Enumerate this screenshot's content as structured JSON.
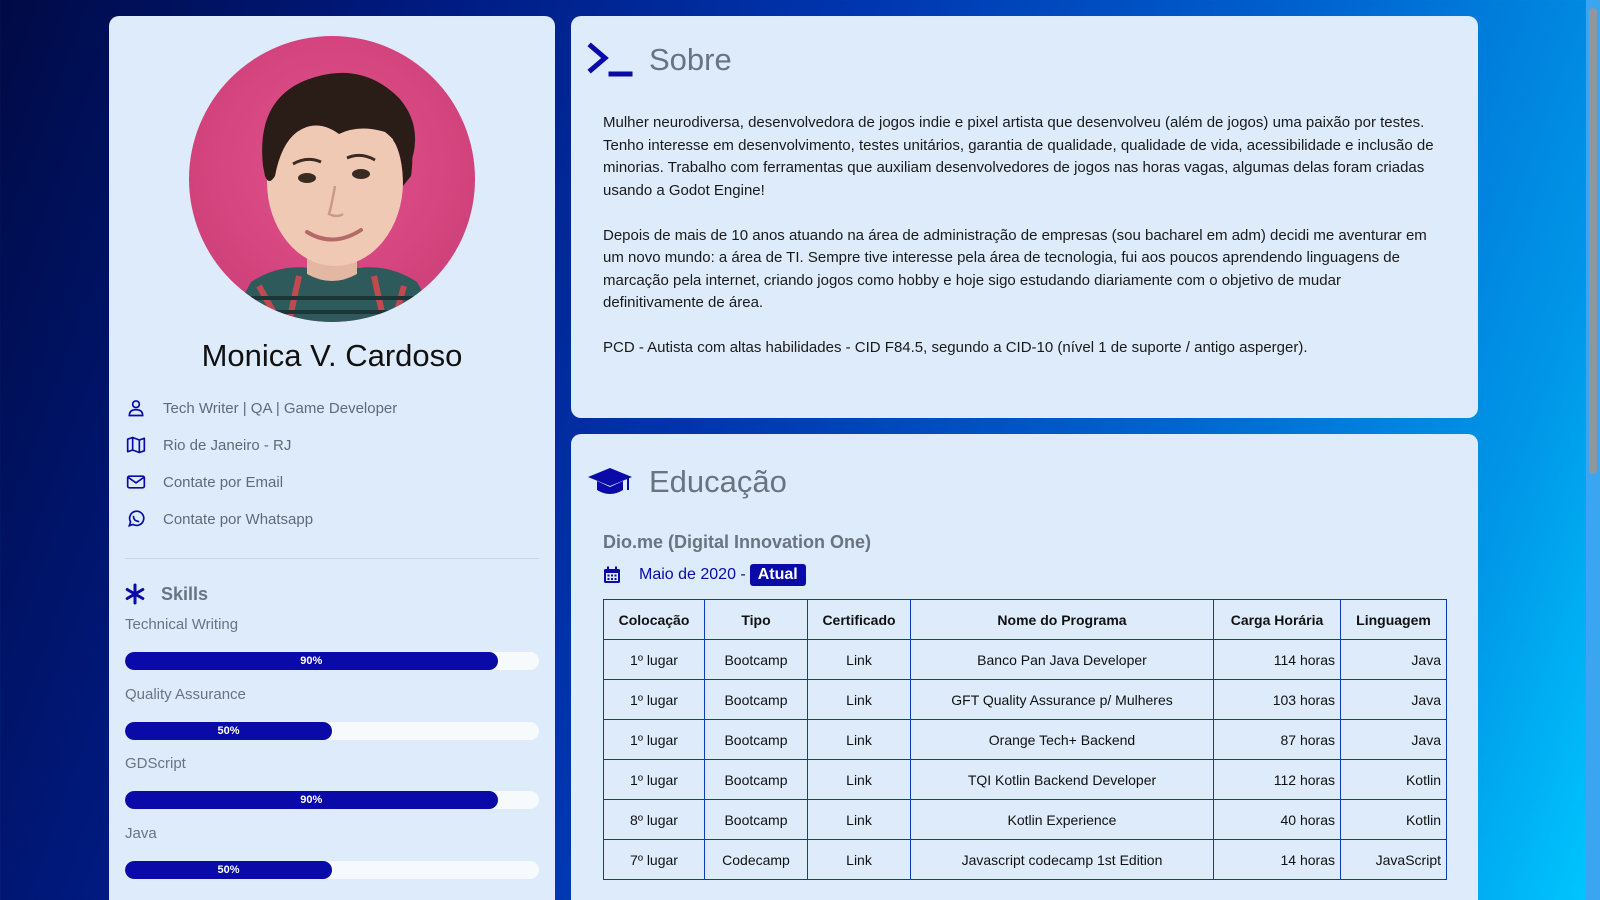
{
  "profile": {
    "name": "Monica V. Cardoso",
    "role": "Tech Writer | QA | Game Developer",
    "location": "Rio de Janeiro - RJ",
    "email_link": "Contate por Email",
    "whatsapp_link": "Contate por Whatsapp"
  },
  "skills": {
    "heading": "Skills",
    "items": [
      {
        "name": "Technical Writing",
        "percent": 90,
        "label": "90%"
      },
      {
        "name": "Quality Assurance",
        "percent": 50,
        "label": "50%"
      },
      {
        "name": "GDScript",
        "percent": 90,
        "label": "90%"
      },
      {
        "name": "Java",
        "percent": 50,
        "label": "50%"
      }
    ]
  },
  "about": {
    "title": "Sobre",
    "paragraphs": [
      "Mulher neurodiversa, desenvolvedora de jogos indie e pixel artista que desenvolveu (além de jogos) uma paixão por testes. Tenho interesse em desenvolvimento, testes unitários, garantia de qualidade, qualidade de vida, acessibilidade e inclusão de minorias. Trabalho com ferramentas que auxiliam desenvolvedores de jogos nas horas vagas, algumas delas foram criadas usando a Godot Engine!",
      "Depois de mais de 10 anos atuando na área de administração de empresas (sou bacharel em adm) decidi me aventurar em um novo mundo: a área de TI. Sempre tive interesse pela área de tecnologia, fui aos poucos aprendendo linguagens de marcação pela internet, criando jogos como hobby e hoje sigo estudando diariamente com o objetivo de mudar definitivamente de área.",
      "PCD - Autista com altas habilidades - CID F84.5, segundo a CID-10 (nível 1 de suporte / antigo asperger)."
    ]
  },
  "education": {
    "title": "Educação",
    "institution": "Dio.me (Digital Innovation One)",
    "date": "Maio de 2020 -",
    "status_badge": "Atual",
    "columns": [
      "Colocação",
      "Tipo",
      "Certificado",
      "Nome do Programa",
      "Carga Horária",
      "Linguagem"
    ],
    "rows": [
      [
        "1º lugar",
        "Bootcamp",
        "Link",
        "Banco Pan Java Developer",
        "114 horas",
        "Java"
      ],
      [
        "1º lugar",
        "Bootcamp",
        "Link",
        "GFT Quality Assurance p/ Mulheres",
        "103 horas",
        "Java"
      ],
      [
        "1º lugar",
        "Bootcamp",
        "Link",
        "Orange Tech+ Backend",
        "87 horas",
        "Java"
      ],
      [
        "1º lugar",
        "Bootcamp",
        "Link",
        "TQI Kotlin Backend Developer",
        "112 horas",
        "Kotlin"
      ],
      [
        "8º lugar",
        "Bootcamp",
        "Link",
        "Kotlin Experience",
        "40 horas",
        "Kotlin"
      ],
      [
        "7º lugar",
        "Codecamp",
        "Link",
        "Javascript codecamp 1st Edition",
        "14 horas",
        "JavaScript"
      ]
    ]
  },
  "icons": {
    "role": "user-icon",
    "location": "map-icon",
    "email": "envelope-icon",
    "whatsapp": "whatsapp-icon",
    "skills": "asterisk-icon",
    "about": "terminal-icon",
    "education": "graduation-cap-icon",
    "date": "calendar-icon"
  },
  "colors": {
    "accent": "#0a0aa8",
    "card_background": "#ddebfa",
    "muted_text": "#6a7480",
    "table_border": "#0a3db5"
  }
}
